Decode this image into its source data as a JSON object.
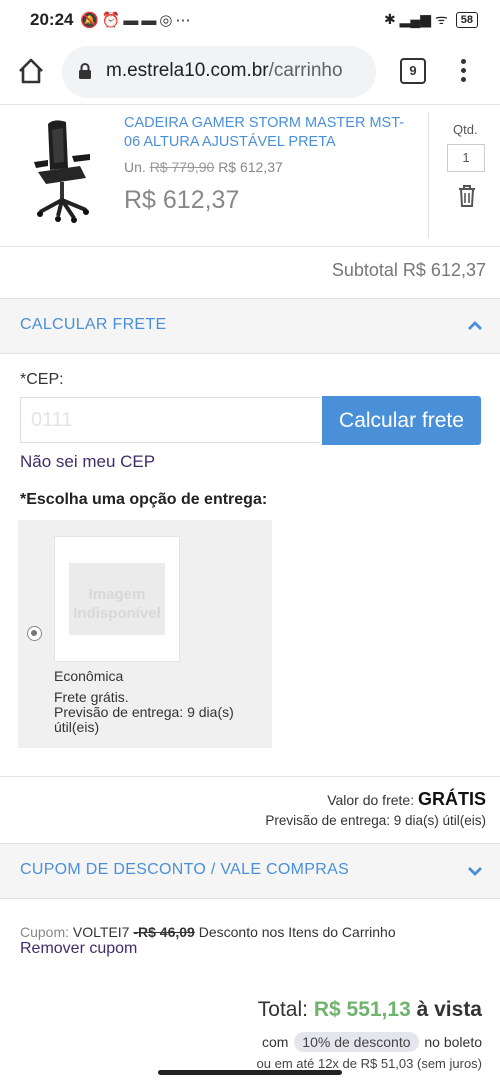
{
  "status_bar": {
    "time": "20:24",
    "left_icons": "🔕⏰▬▬◎⋯",
    "right_icons": "✱ ▂▄▆ ᯤ",
    "battery": "58"
  },
  "browser": {
    "url_domain": "m.estrela10.com.br",
    "url_path": "/carrinho",
    "tabs_count": "9"
  },
  "product": {
    "name": "CADEIRA GAMER STORM MASTER MST-06 ALTURA AJUSTÁVEL PRETA",
    "unit_label": "Un.",
    "old_price": "R$ 779,90",
    "unit_price": "R$ 612,37",
    "total_price": "R$ 612,37",
    "qty_label": "Qtd.",
    "qty_value": "1"
  },
  "subtotal": "Subtotal R$ 612,37",
  "shipping": {
    "section_title": "CALCULAR FRETE",
    "cep_label": "*CEP:",
    "cep_value": "0111",
    "calc_button": "Calcular frete",
    "unknown_cep_link": "Não sei meu CEP",
    "choose_title": "*Escolha uma opção de entrega:",
    "option": {
      "image_text_1": "Imagem",
      "image_text_2": "Indisponível",
      "name": "Econômica",
      "line1": "Frete grátis.",
      "line2": "Previsão de entrega: 9 dia(s) útil(eis)"
    },
    "value_label": "Valor do frete:",
    "value": "GRÁTIS",
    "forecast": "Previsão de entrega: 9 dia(s) útil(eis)"
  },
  "coupon": {
    "section_title": "CUPOM DE DESCONTO / VALE COMPRAS",
    "label": "Cupom:",
    "code": "VOLTEI7",
    "discount": "-R$ 46,09",
    "description": "Desconto nos Itens do Carrinho",
    "remove_link": "Remover cupom"
  },
  "totals": {
    "label": "Total:",
    "amount": "R$ 551,13",
    "suffix": "à vista",
    "boleto_prefix": "com",
    "boleto_badge": "10% de desconto",
    "boleto_suffix": "no boleto",
    "installments": "ou em até 12x de R$ 51,03 (sem juros)"
  },
  "colors": {
    "accent": "#4a90d9",
    "link_dark": "#3f2d6b",
    "total_green": "#6fb36f"
  }
}
